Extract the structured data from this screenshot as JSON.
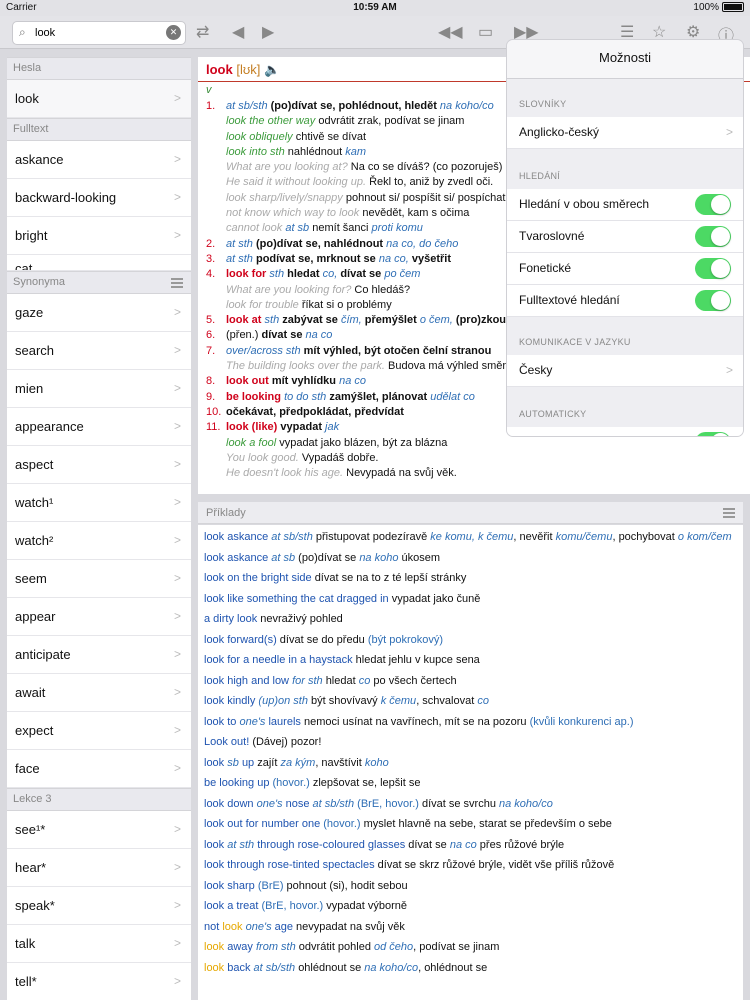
{
  "status": {
    "carrier": "Carrier",
    "time": "10:59 AM",
    "battery": "100%"
  },
  "search": {
    "value": "look"
  },
  "sidebar": {
    "sections": [
      {
        "title": "Hesla",
        "items": [
          "look"
        ]
      },
      {
        "title": "Fulltext",
        "items": [
          "askance",
          "backward-looking",
          "bright",
          "cat"
        ]
      },
      {
        "title": "Synonyma",
        "items": [
          "gaze",
          "search",
          "mien",
          "appearance",
          "aspect",
          "watch¹",
          "watch²",
          "seem",
          "appear",
          "anticipate",
          "await",
          "expect",
          "face"
        ]
      },
      {
        "title": "Lekce 3",
        "items": [
          "see¹*",
          "hear*",
          "speak*",
          "talk",
          "tell*"
        ]
      }
    ]
  },
  "entry": {
    "headword": "look",
    "pronunciation": "[lʊk]",
    "pos": "v",
    "lines": [
      [
        {
          "t": "1.",
          "c": "num"
        },
        {
          "t": "at sb/sth ",
          "c": "bl"
        },
        {
          "t": "(po)dívat se, pohlédnout, hledět ",
          "c": "b"
        },
        {
          "t": "na koho/co",
          "c": "bl"
        }
      ],
      [
        {
          "t": "look the other way ",
          "c": "gr ind"
        },
        {
          "t": "odvrátit zrak, podívat se jinam",
          "c": ""
        }
      ],
      [
        {
          "t": "look obliquely ",
          "c": "gr ind"
        },
        {
          "t": "chtivě se dívat",
          "c": ""
        }
      ],
      [
        {
          "t": "look into sth ",
          "c": "gr ind"
        },
        {
          "t": "nahlédnout ",
          "c": ""
        },
        {
          "t": "kam",
          "c": "bl"
        }
      ],
      [
        {
          "t": "What are you looking at? ",
          "c": "gy ind"
        },
        {
          "t": "Na co se díváš? ",
          "c": ""
        },
        {
          "t": "(co pozoruješ)",
          "c": "g"
        }
      ],
      [
        {
          "t": "He said it without looking up. ",
          "c": "gy ind"
        },
        {
          "t": "Řekl to, aniž by zvedl oči.",
          "c": ""
        }
      ],
      [
        {
          "t": "look sharp/lively/snappy ",
          "c": "gy ind"
        },
        {
          "t": "pohnout si/ pospíšit si/ pospíchat",
          "c": ""
        }
      ],
      [
        {
          "t": "not know which way to look ",
          "c": "gy ind"
        },
        {
          "t": "nevědět, kam s očima",
          "c": ""
        }
      ],
      [
        {
          "t": "cannot look ",
          "c": "gy ind"
        },
        {
          "t": "at sb ",
          "c": "bl"
        },
        {
          "t": "nemít šanci ",
          "c": ""
        },
        {
          "t": "proti komu",
          "c": "bl"
        }
      ],
      [
        {
          "t": "2.",
          "c": "num"
        },
        {
          "t": "at sth ",
          "c": "bl"
        },
        {
          "t": "(po)dívat se, nahlédnout ",
          "c": "b"
        },
        {
          "t": "na co, do čeho",
          "c": "bl"
        }
      ],
      [
        {
          "t": "3.",
          "c": "num"
        },
        {
          "t": "at sth ",
          "c": "bl"
        },
        {
          "t": "podívat se, mrknout se ",
          "c": "b"
        },
        {
          "t": "na co, ",
          "c": "bl"
        },
        {
          "t": "vyšetřit",
          "c": "b"
        }
      ],
      [
        {
          "t": "4.",
          "c": "num"
        },
        {
          "t": "look for ",
          "c": "rd"
        },
        {
          "t": "sth ",
          "c": "bl"
        },
        {
          "t": "hledat ",
          "c": "b"
        },
        {
          "t": "co, ",
          "c": "bl"
        },
        {
          "t": "dívat se ",
          "c": "b"
        },
        {
          "t": "po čem",
          "c": "bl"
        }
      ],
      [
        {
          "t": "What are you looking for? ",
          "c": "gy ind"
        },
        {
          "t": "Co hledáš?",
          "c": ""
        }
      ],
      [
        {
          "t": "look for trouble ",
          "c": "gy ind"
        },
        {
          "t": "říkat si o problémy",
          "c": ""
        }
      ],
      [
        {
          "t": "5.",
          "c": "num"
        },
        {
          "t": "look at ",
          "c": "rd"
        },
        {
          "t": "sth ",
          "c": "bl"
        },
        {
          "t": "zabývat se ",
          "c": "b"
        },
        {
          "t": "čím, ",
          "c": "bl"
        },
        {
          "t": "přemýšlet ",
          "c": "b"
        },
        {
          "t": "o čem, ",
          "c": "bl"
        },
        {
          "t": "(pro)zkoumat",
          "c": "b"
        }
      ],
      [
        {
          "t": "6.",
          "c": "num"
        },
        {
          "t": "(přen.) ",
          "c": "g"
        },
        {
          "t": "dívat se ",
          "c": "b"
        },
        {
          "t": "na co",
          "c": "bl"
        }
      ],
      [
        {
          "t": "7.",
          "c": "num"
        },
        {
          "t": "over/across sth ",
          "c": "bl"
        },
        {
          "t": "mít výhled, být otočen čelní stranou",
          "c": "b"
        }
      ],
      [
        {
          "t": "The building looks over the park. ",
          "c": "gy ind"
        },
        {
          "t": "Budova má výhled směrem",
          "c": ""
        }
      ],
      [
        {
          "t": "8.",
          "c": "num"
        },
        {
          "t": "look out ",
          "c": "rd"
        },
        {
          "t": "mít vyhlídku ",
          "c": "b"
        },
        {
          "t": "na co",
          "c": "bl"
        }
      ],
      [
        {
          "t": "9.",
          "c": "num"
        },
        {
          "t": "be looking ",
          "c": "rd"
        },
        {
          "t": "to do sth ",
          "c": "bl"
        },
        {
          "t": "zamýšlet, plánovat ",
          "c": "b"
        },
        {
          "t": "udělat co",
          "c": "bl"
        }
      ],
      [
        {
          "t": "10.",
          "c": "num"
        },
        {
          "t": "očekávat, předpokládat, předvídat",
          "c": "b"
        }
      ],
      [
        {
          "t": "11.",
          "c": "num"
        },
        {
          "t": "look (like) ",
          "c": "rd"
        },
        {
          "t": "vypadat ",
          "c": "b"
        },
        {
          "t": "jak",
          "c": "bl"
        }
      ],
      [
        {
          "t": "look a fool ",
          "c": "gr ind"
        },
        {
          "t": "vypadat jako blázen, být za blázna",
          "c": ""
        }
      ],
      [
        {
          "t": "You look good. ",
          "c": "gy ind"
        },
        {
          "t": "Vypadáš dobře.",
          "c": ""
        }
      ],
      [
        {
          "t": "He doesn't look his age. ",
          "c": "gy ind"
        },
        {
          "t": "Nevypadá na svůj věk.",
          "c": ""
        }
      ]
    ]
  },
  "settings": {
    "title": "Možnosti",
    "groups": {
      "dictionaries": "SLOVNÍKY",
      "search": "HLEDÁNÍ",
      "language": "KOMUNIKACE V JAZYKU",
      "auto": "AUTOMATICKY"
    },
    "dictionary": "Anglicko-český",
    "toggles": [
      {
        "label": "Hledání v obou směrech",
        "on": true
      },
      {
        "label": "Tvaroslovné",
        "on": true
      },
      {
        "label": "Fonetické",
        "on": true
      },
      {
        "label": "Fulltextové hledání",
        "on": true
      }
    ],
    "language": "Česky"
  },
  "examples": {
    "title": "Příklady",
    "items": [
      [
        {
          "t": "look askance ",
          "c": "d"
        },
        {
          "t": "at sb/sth ",
          "c": "i"
        },
        {
          "t": "  přistupovat podezíravě ",
          "c": ""
        },
        {
          "t": "ke komu, k čemu",
          "c": "i"
        },
        {
          "t": ", nevěřit ",
          "c": ""
        },
        {
          "t": "komu/čemu",
          "c": "i"
        },
        {
          "t": ", pochybovat ",
          "c": ""
        },
        {
          "t": "o kom/čem",
          "c": "i"
        }
      ],
      [
        {
          "t": "look askance ",
          "c": "d"
        },
        {
          "t": "at sb ",
          "c": "i"
        },
        {
          "t": "  (po)dívat se ",
          "c": ""
        },
        {
          "t": "na koho ",
          "c": "i"
        },
        {
          "t": "úkosem",
          "c": ""
        }
      ],
      [
        {
          "t": "look on the bright side ",
          "c": "d"
        },
        {
          "t": "  dívat se na to z té lepší stránky",
          "c": ""
        }
      ],
      [
        {
          "t": "look like something the cat dragged in ",
          "c": "d"
        },
        {
          "t": "  vypadat jako čuně",
          "c": ""
        }
      ],
      [
        {
          "t": "a dirty look ",
          "c": "d"
        },
        {
          "t": "  nevraživý pohled",
          "c": ""
        }
      ],
      [
        {
          "t": "look forward(s) ",
          "c": "d"
        },
        {
          "t": "  dívat se do předu ",
          "c": ""
        },
        {
          "t": "(být pokrokový)",
          "c": "g"
        }
      ],
      [
        {
          "t": "look for a needle in a haystack ",
          "c": "d"
        },
        {
          "t": "  hledat jehlu v kupce sena",
          "c": ""
        }
      ],
      [
        {
          "t": "look high and low ",
          "c": "d"
        },
        {
          "t": "for sth ",
          "c": "i"
        },
        {
          "t": "  hledat ",
          "c": ""
        },
        {
          "t": "co ",
          "c": "i"
        },
        {
          "t": "po všech čertech",
          "c": ""
        }
      ],
      [
        {
          "t": "look kindly ",
          "c": "d"
        },
        {
          "t": "(up)on sth ",
          "c": "i"
        },
        {
          "t": "  být shovívavý ",
          "c": ""
        },
        {
          "t": "k čemu",
          "c": "i"
        },
        {
          "t": ", schvalovat ",
          "c": ""
        },
        {
          "t": "co",
          "c": "i"
        }
      ],
      [
        {
          "t": "look to ",
          "c": "d"
        },
        {
          "t": "one's ",
          "c": "i"
        },
        {
          "t": "laurels ",
          "c": "d"
        },
        {
          "t": "  nemoci usínat na vavřínech, mít se na pozoru ",
          "c": ""
        },
        {
          "t": "(kvůli konkurenci ap.)",
          "c": "g"
        }
      ],
      [
        {
          "t": "Look out! ",
          "c": "d"
        },
        {
          "t": "  (Dávej) pozor!",
          "c": ""
        }
      ],
      [
        {
          "t": "look ",
          "c": "d"
        },
        {
          "t": "sb ",
          "c": "i"
        },
        {
          "t": "up ",
          "c": "d"
        },
        {
          "t": "  zajít ",
          "c": ""
        },
        {
          "t": "za kým",
          "c": "i"
        },
        {
          "t": ", navštívit ",
          "c": ""
        },
        {
          "t": "koho",
          "c": "i"
        }
      ],
      [
        {
          "t": "be looking up ",
          "c": "d"
        },
        {
          "t": "  (hovor.) ",
          "c": "g"
        },
        {
          "t": "zlepšovat se, lepšit se",
          "c": ""
        }
      ],
      [
        {
          "t": "look down ",
          "c": "d"
        },
        {
          "t": "one's ",
          "c": "i"
        },
        {
          "t": "nose ",
          "c": "d"
        },
        {
          "t": "at sb/sth ",
          "c": "i"
        },
        {
          "t": "  (BrE, hovor.) ",
          "c": "g"
        },
        {
          "t": "dívat se svrchu ",
          "c": ""
        },
        {
          "t": "na koho/co",
          "c": "i"
        }
      ],
      [
        {
          "t": "look out for number one ",
          "c": "d"
        },
        {
          "t": "  (hovor.) ",
          "c": "g"
        },
        {
          "t": "myslet hlavně na sebe, starat se především o sebe",
          "c": ""
        }
      ],
      [
        {
          "t": "look ",
          "c": "d"
        },
        {
          "t": "at sth ",
          "c": "i"
        },
        {
          "t": "through rose-coloured glasses ",
          "c": "d"
        },
        {
          "t": "  dívat se ",
          "c": ""
        },
        {
          "t": "na co ",
          "c": "i"
        },
        {
          "t": "přes růžové brýle",
          "c": ""
        }
      ],
      [
        {
          "t": "look through rose-tinted spectacles ",
          "c": "d"
        },
        {
          "t": "  dívat se skrz růžové brýle, vidět vše příliš růžově",
          "c": ""
        }
      ],
      [
        {
          "t": "look sharp ",
          "c": "d"
        },
        {
          "t": "  (BrE) ",
          "c": "g"
        },
        {
          "t": "pohnout (si), hodit sebou",
          "c": ""
        }
      ],
      [
        {
          "t": "look a treat ",
          "c": "d"
        },
        {
          "t": "  (BrE, hovor.) ",
          "c": "g"
        },
        {
          "t": "vypadat výborně",
          "c": ""
        }
      ],
      [
        {
          "t": "not ",
          "c": "d"
        },
        {
          "t": "look ",
          "c": "y"
        },
        {
          "t": "one's ",
          "c": "i"
        },
        {
          "t": "age ",
          "c": "d"
        },
        {
          "t": "  nevypadat na svůj věk",
          "c": ""
        }
      ],
      [
        {
          "t": "look ",
          "c": "y"
        },
        {
          "t": "away ",
          "c": "d"
        },
        {
          "t": "from sth ",
          "c": "i"
        },
        {
          "t": "  odvrátit pohled ",
          "c": ""
        },
        {
          "t": "od čeho",
          "c": "i"
        },
        {
          "t": ", podívat se jinam",
          "c": ""
        }
      ],
      [
        {
          "t": "look ",
          "c": "y"
        },
        {
          "t": "back ",
          "c": "d"
        },
        {
          "t": "at sb/sth ",
          "c": "i"
        },
        {
          "t": "  ohlédnout se ",
          "c": ""
        },
        {
          "t": "na koho/co",
          "c": "i"
        },
        {
          "t": ", ohlédnout se",
          "c": ""
        }
      ]
    ]
  }
}
